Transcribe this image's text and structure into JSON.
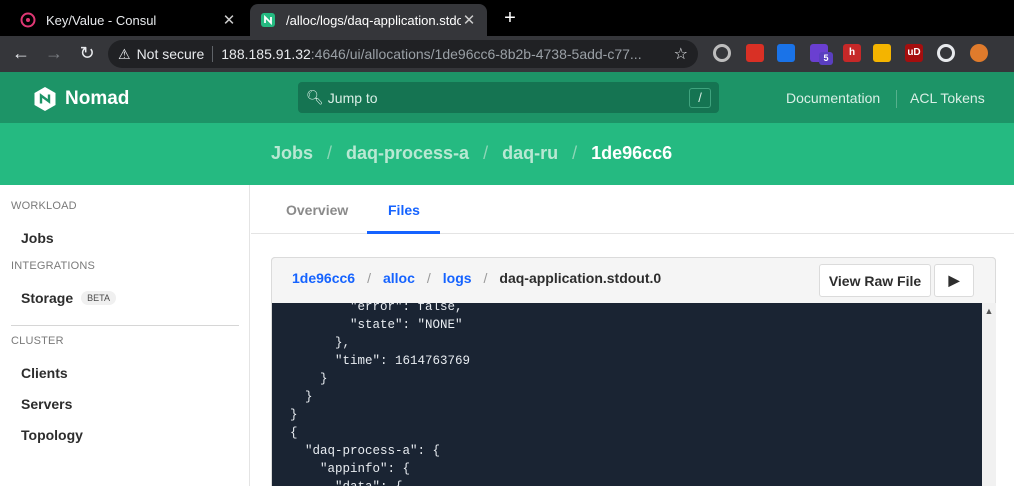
{
  "browser": {
    "tabs": [
      {
        "title": "Key/Value - Consul",
        "close": "✕"
      },
      {
        "title": "/alloc/logs/daq-application.stdout.0",
        "close": "✕"
      }
    ],
    "new_tab": "+",
    "nav": {
      "back": "←",
      "forward": "→",
      "reload": "↻"
    },
    "address": {
      "security": "Not secure",
      "host": "188.185.91.32",
      "rest": ":4646/ui/allocations/1de96cc6-8b2b-4738-5add-c77...",
      "star": "☆"
    },
    "extensions": [
      {
        "name": "gear-extension-icon",
        "color": "#bdbdbd"
      },
      {
        "name": "red-dots-extension-icon",
        "color": "#d93025"
      },
      {
        "name": "blue-extension-icon",
        "color": "#1a73e8"
      },
      {
        "name": "purple-badge-extension-icon",
        "color": "#6a3fd1",
        "badge": "5"
      },
      {
        "name": "h-extension-icon",
        "color": "#c62828",
        "label": "h"
      },
      {
        "name": "hex-extension-icon",
        "color": "#f4b400"
      },
      {
        "name": "ublock-extension-icon",
        "color": "#a50e0e",
        "label": "uD"
      },
      {
        "name": "puzzle-extension-icon",
        "color": "#e8eaed"
      },
      {
        "name": "fox-avatar-icon",
        "color": "#e07b2c"
      }
    ]
  },
  "header": {
    "brand": "Nomad",
    "search_placeholder": "Jump to",
    "search_shortcut": "/",
    "links": {
      "documentation": "Documentation",
      "acl_tokens": "ACL Tokens"
    }
  },
  "breadcrumbs": [
    "Jobs",
    "daq-process-a",
    "daq-ru",
    "1de96cc6"
  ],
  "sidebar": {
    "workload_heading": "WORKLOAD",
    "jobs": "Jobs",
    "integrations_heading": "INTEGRATIONS",
    "storage": "Storage",
    "beta": "BETA",
    "cluster_heading": "CLUSTER",
    "clients": "Clients",
    "servers": "Servers",
    "topology": "Topology"
  },
  "subnav": {
    "overview": "Overview",
    "files": "Files"
  },
  "file": {
    "path": [
      "1de96cc6",
      "alloc",
      "logs"
    ],
    "filename": "daq-application.stdout.0",
    "view_raw": "View Raw File",
    "play": "▶",
    "content": "        \"error\": false,\n        \"state\": \"NONE\"\n      },\n      \"time\": 1614763769\n    }\n  }\n}\n{\n  \"daq-process-a\": {\n    \"appinfo\": {\n      \"data\": {"
  },
  "colors": {
    "nomad_dark": "#1d9467",
    "nomad_green": "#25ba81",
    "link_blue": "#1563ff",
    "code_bg": "#1a2433"
  }
}
